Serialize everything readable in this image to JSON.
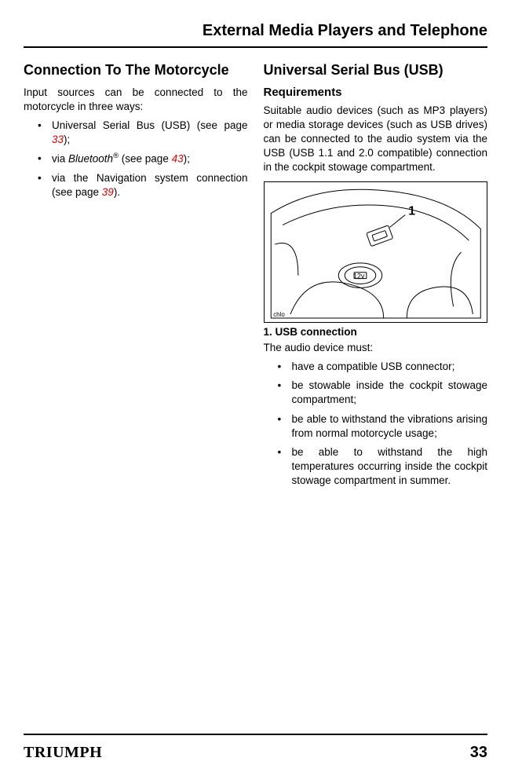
{
  "header": "External Media Players and Telephone",
  "left": {
    "heading": "Connection To The Motorcycle",
    "intro": "Input sources can be connected to the motorcycle in three ways:",
    "items": [
      {
        "pre": "Universal Serial Bus (USB) (see page ",
        "page": "33",
        "post": ");"
      },
      {
        "pre": "via ",
        "em": "Bluetooth",
        "sup": "®",
        "mid": " (see page ",
        "page": "43",
        "post": ");"
      },
      {
        "pre": "via the Navigation system connection (see page ",
        "page": "39",
        "post": ")."
      }
    ]
  },
  "right": {
    "heading": "Universal Serial Bus (USB)",
    "sub": "Requirements",
    "para": "Suitable audio devices (such as MP3 players) or media storage devices (such as USB drives) can be connected to the audio system via the USB (USB 1.1 and 2.0 compatible) connection in the cockpit stowage compartment.",
    "fig_label_num": "1",
    "fig_label_12v": "12v",
    "fig_tag": "chlo",
    "fig_caption": "1.  USB connection",
    "lead": "The audio device must:",
    "reqs": [
      "have a compatible USB connector;",
      "be stowable inside the cockpit stowage compartment;",
      "be able to withstand the vibrations arising from normal motorcycle usage;",
      "be able to withstand the high temperatures occurring inside the cockpit stowage compartment in summer."
    ]
  },
  "footer": {
    "logo": "TRIUMPH",
    "page": "33"
  }
}
